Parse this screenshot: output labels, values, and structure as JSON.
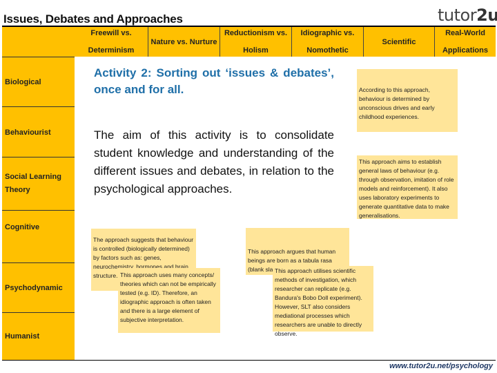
{
  "page": {
    "title": "Issues, Debates and Approaches",
    "logo": {
      "text_main": "tutor",
      "text_accent": "2u",
      "spark_icon": "sparkle-icon"
    },
    "footer_url": "www.tutor2u.net/psychology"
  },
  "header": {
    "columns": [
      {
        "line1": "Freewill vs.",
        "line2": "Determinism"
      },
      {
        "line1": "Nature vs. Nurture",
        "line2": ""
      },
      {
        "line1": "Reductionism vs.",
        "line2": "Holism"
      },
      {
        "line1": "Idiographic vs.",
        "line2": "Nomothetic"
      },
      {
        "line1": "Scientific",
        "line2": ""
      },
      {
        "line1": "Real-World",
        "line2": "Applications"
      }
    ]
  },
  "sidebar": {
    "approaches": [
      {
        "label": "Biological"
      },
      {
        "label": "Behaviourist"
      },
      {
        "label": "Social Learning Theory"
      },
      {
        "label": "Cognitive"
      },
      {
        "label": "Psychodynamic"
      },
      {
        "label": "Humanist"
      }
    ]
  },
  "activity": {
    "heading": "Activity 2: Sorting out ‘issues & debates’, once and for all.",
    "body": "The aim of this activity is to consolidate student knowledge and understanding of the different issues and debates, in relation to the psychological approaches."
  },
  "cards": [
    {
      "id": "psychodynamic-determinism",
      "text": "According to this approach, behaviour is determined by unconscious drives and early childhood experiences."
    },
    {
      "id": "behaviourist-nomothetic",
      "text": "This approach aims to establish general laws of behaviour (e.g. through observation, imitation of role models and reinforcement). It also uses laboratory experiments to generate quantitative data to make generalisations."
    },
    {
      "id": "biological-determinism",
      "text": "The approach suggests that behaviour is controlled (biologically determined) by factors such as: genes, neurochemistry, hormones and brain structure."
    },
    {
      "id": "psychodynamic-scientific",
      "text": "This approach uses many concepts/ theories which can not be empirically tested (e.g. ID). Therefore, an idiographic approach is often taken and there is a large element of subjective interpretation."
    },
    {
      "id": "behaviourist-nurture",
      "text": "This approach argues that human beings are born as a tabula rasa (blank slate) and..."
    },
    {
      "id": "slt-scientific",
      "text": "This approach utilises scientific methods of investigation, which researcher can replicate (e.g. Bandura's Bobo Doll experiment). However, SLT also considers mediational processes which researchers are unable to directly observe."
    }
  ],
  "colors": {
    "header_yellow": "#ffc000",
    "card_yellow": "#ffe599",
    "card_light": "#fff2cc",
    "heading_blue": "#1f6fa8",
    "footer_navy": "#1f3864"
  }
}
